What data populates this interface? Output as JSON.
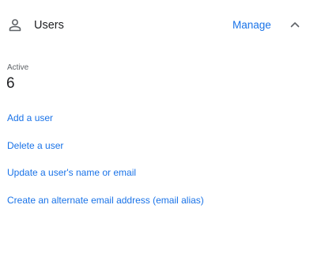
{
  "header": {
    "title": "Users",
    "manage_label": "Manage",
    "icon": "person-outline-icon",
    "collapse_icon": "chevron-up-icon"
  },
  "stats": {
    "active_label": "Active",
    "active_value": "6"
  },
  "links": [
    {
      "label": "Add a user"
    },
    {
      "label": "Delete a user"
    },
    {
      "label": "Update a user's name or email"
    },
    {
      "label": "Create an alternate email address (email alias)"
    }
  ],
  "colors": {
    "link": "#1a73e8",
    "text": "#202124",
    "secondary": "#5f6368"
  }
}
